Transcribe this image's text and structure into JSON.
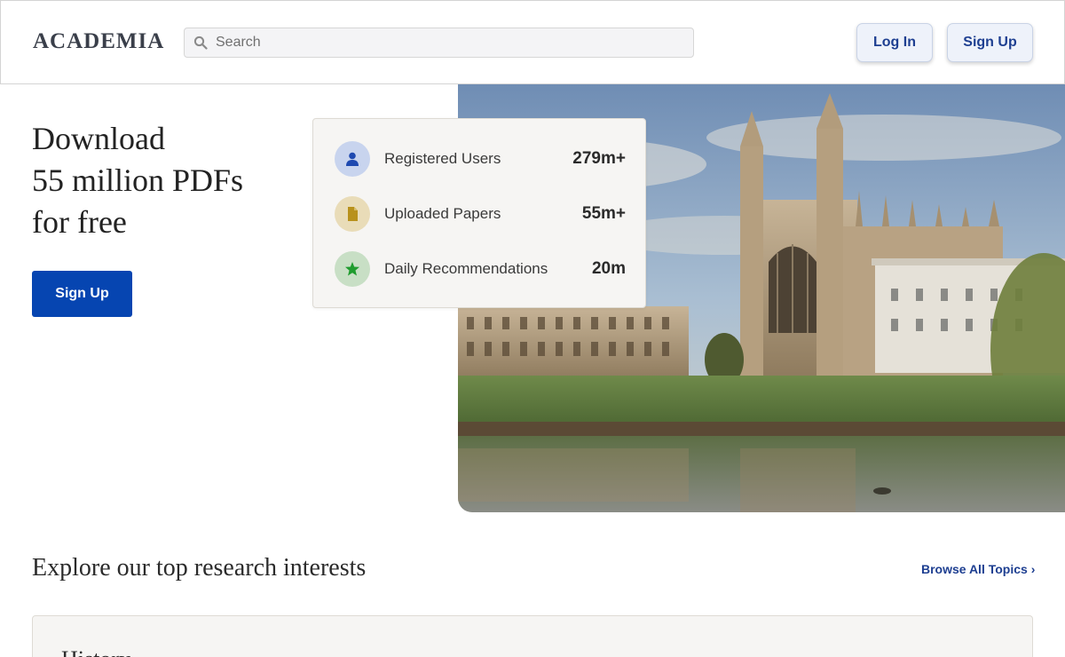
{
  "header": {
    "logo": "ACADEMIA",
    "search_placeholder": "Search",
    "login_label": "Log In",
    "signup_label": "Sign Up"
  },
  "hero": {
    "title_lines": [
      "Download",
      "55 million PDFs",
      "for free"
    ],
    "signup_label": "Sign Up",
    "image_icon": "university-photo"
  },
  "stats": [
    {
      "label": "Registered Users",
      "value": "279m+",
      "icon": "user-icon",
      "icon_bg": "#c8d4ee",
      "icon_color": "#1e49b0"
    },
    {
      "label": "Uploaded Papers",
      "value": "55m+",
      "icon": "paper-icon",
      "icon_bg": "#e9dcb8",
      "icon_color": "#b8911c"
    },
    {
      "label": "Daily Recommendations",
      "value": "20m",
      "icon": "star-icon",
      "icon_bg": "#c8dfc5",
      "icon_color": "#1f9c2e"
    }
  ],
  "explore": {
    "title": "Explore our top research interests",
    "browse_label": "Browse All Topics ›",
    "first_topic": "History"
  },
  "colors": {
    "brand_blue": "#0645b1",
    "link_blue": "#1e3f91"
  }
}
